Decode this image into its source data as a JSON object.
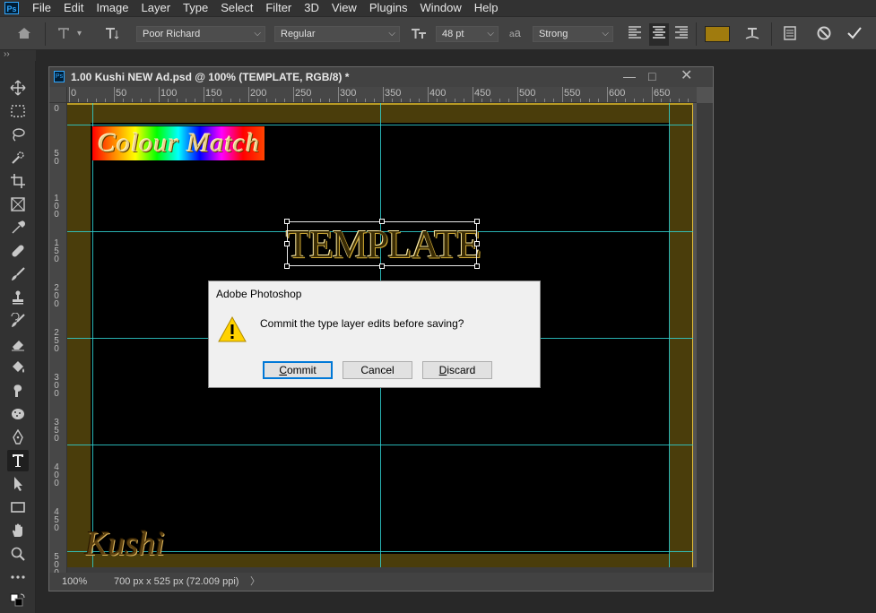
{
  "app": {
    "logo": "Ps"
  },
  "menu": [
    "File",
    "Edit",
    "Image",
    "Layer",
    "Type",
    "Select",
    "Filter",
    "3D",
    "View",
    "Plugins",
    "Window",
    "Help"
  ],
  "options": {
    "font_family": "Poor Richard",
    "font_style": "Regular",
    "font_size": "48 pt",
    "aa_label": "a",
    "antialias": "Strong",
    "text_color": "#a07b0e"
  },
  "document": {
    "title": "1.00  Kushi NEW Ad.psd @ 100% (TEMPLATE, RGB/8) *",
    "hruler_labels": [
      "0",
      "50",
      "100",
      "150",
      "200",
      "250",
      "300",
      "350",
      "400",
      "450",
      "500",
      "550",
      "600",
      "650"
    ],
    "vruler_labels": [
      "0",
      "50",
      "100",
      "150",
      "200",
      "250",
      "300",
      "350",
      "400",
      "450",
      "500"
    ],
    "canvas_texts": {
      "colour_match": "Colour Match",
      "template": "TEMPLATE",
      "kushi": "Kushi"
    },
    "status": {
      "zoom": "100%",
      "info": "700 px x 525 px (72.009 ppi)",
      "arrow": "〉"
    }
  },
  "dialog": {
    "title": "Adobe Photoshop",
    "message": "Commit the type layer edits before saving?",
    "buttons": {
      "commit_pre": "",
      "commit_u": "C",
      "commit_rest": "ommit",
      "cancel": "Cancel",
      "discard_pre": "",
      "discard_u": "D",
      "discard_rest": "iscard"
    }
  },
  "tools_header": "››"
}
